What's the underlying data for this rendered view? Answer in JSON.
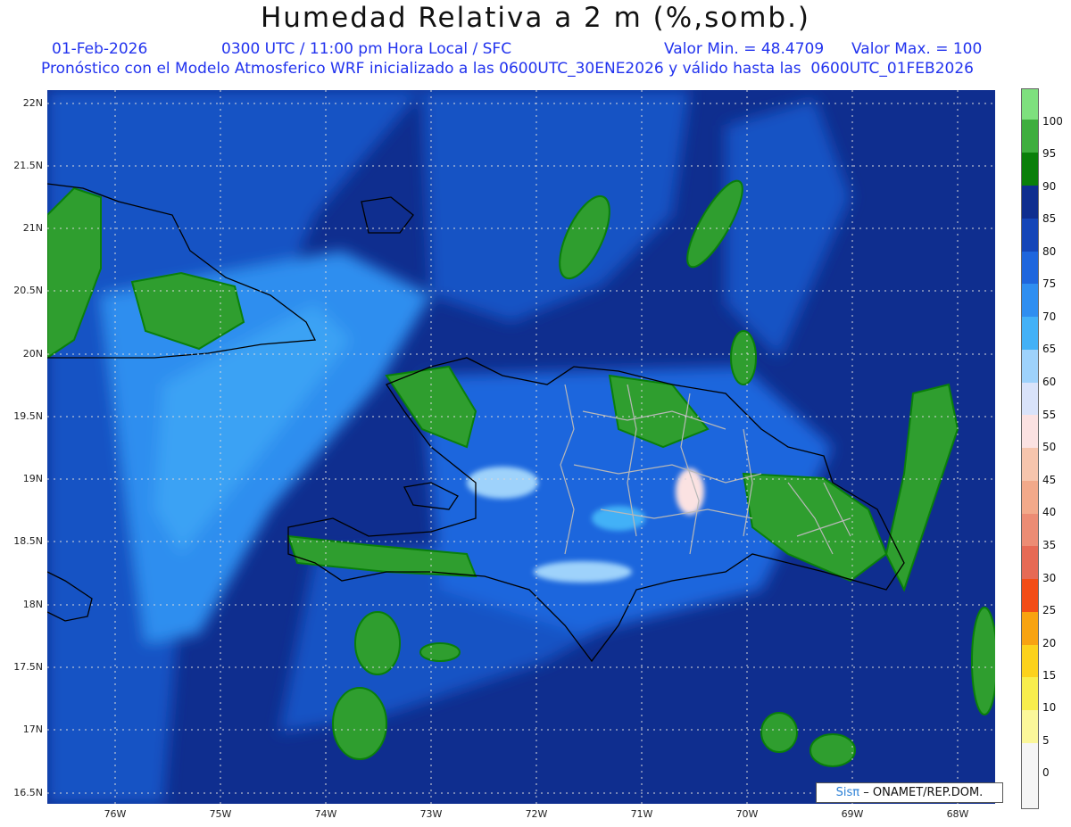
{
  "header": {
    "title": "Humedad Relativa a 2 m (%,somb.)",
    "date": "01-Feb-2026",
    "time": "0300 UTC / 11:00 pm Hora Local / SFC",
    "vmin": "Valor Min. = 48.4709",
    "vmax": "Valor Max. = 100",
    "info": "Pronóstico con el Modelo Atmosferico WRF inicializado a las 0600UTC_30ENE2026 y válido hasta las  0600UTC_01FEB2026"
  },
  "axes": {
    "lat_labels": [
      "22N",
      "21.5N",
      "21N",
      "20.5N",
      "20N",
      "19.5N",
      "19N",
      "18.5N",
      "18N",
      "17.5N",
      "17N",
      "16.5N"
    ],
    "lon_labels": [
      "76W",
      "75W",
      "74W",
      "73W",
      "72W",
      "71W",
      "70W",
      "69W",
      "68W"
    ]
  },
  "colorbar": {
    "labels": [
      "100",
      "95",
      "90",
      "85",
      "80",
      "75",
      "70",
      "65",
      "60",
      "55",
      "50",
      "45",
      "40",
      "35",
      "30",
      "25",
      "20",
      "15",
      "10",
      "5",
      "0"
    ],
    "colors": [
      "#7ee07e",
      "#3fae3f",
      "#0a7f0a",
      "#0f2e8f",
      "#1546b8",
      "#1f66dd",
      "#2f8ef0",
      "#43b1f7",
      "#9ed2fb",
      "#d9e3fa",
      "#fbe2e2",
      "#f6c5ad",
      "#f2a98a",
      "#ec8c74",
      "#e66a55",
      "#f24d17",
      "#f8a311",
      "#fcd21c",
      "#f8ee4d",
      "#fbf79a",
      "#f5f5f5"
    ]
  },
  "map": {
    "ocean_color": "#0f2e8f",
    "moist_color": "#1852c4",
    "dry_color": "#3aa2f4",
    "land_green": "#2f9e2f"
  },
  "credit": {
    "brand": "Sisπ",
    "text": "– ONAMET/REP.DOM."
  }
}
